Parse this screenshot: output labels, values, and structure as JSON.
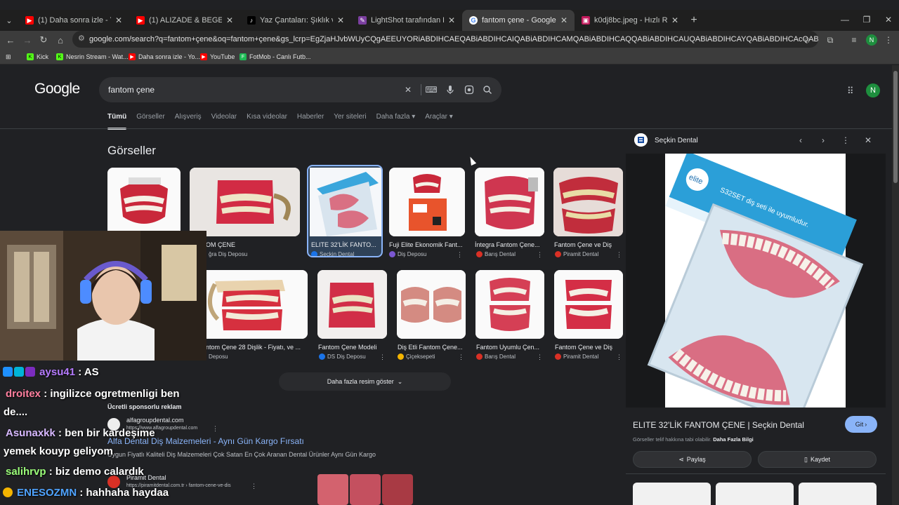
{
  "browser": {
    "tabs": [
      {
        "title": "(1) Daha sonra izle - YouTube",
        "favicon": "youtube-icon",
        "color": "#ff0000"
      },
      {
        "title": "(1) ALIZADE & BEGE - 24/7 (Of...",
        "favicon": "youtube-icon",
        "color": "#ff0000"
      },
      {
        "title": "Yaz Çantaları: Şıklık ve Kullanışlı...",
        "favicon": "tiktok-icon",
        "color": "#000000"
      },
      {
        "title": "LightShot tarafından Ekran Görü...",
        "favicon": "feather-icon",
        "color": "#9b59b6"
      },
      {
        "title": "fantom çene - Google'da Ara",
        "favicon": "google-icon",
        "color": "#4285f4"
      },
      {
        "title": "k0dj8bc.jpeg - Hızlı Resim",
        "favicon": "image-icon",
        "color": "#c2185b"
      }
    ],
    "new_tab": "+",
    "url": "google.com/search?q=fantom+çene&oq=fantom+çene&gs_lcrp=EgZjaHJvbWUyCQgAEEUYORiABDIHCAEQABiABDIHCAIQABiABDIHCAMQABiABDIHCAQQABiABDIHCAUQABiABDIHCAYQABiABDIHCAcQABiABDIHCAgQABiABDIHCAkQABiABNI...",
    "profile_initial": "N",
    "bookmarks": [
      {
        "label": "Kick",
        "color": "#53fc18"
      },
      {
        "label": "Nesrin Stream - Wat...",
        "color": "#53fc18"
      },
      {
        "label": "Daha sonra izle - Yo...",
        "color": "#ff0000"
      },
      {
        "label": "YouTube",
        "color": "#ff0000"
      },
      {
        "label": "FotMob - Canlı Futb...",
        "color": "#1db954"
      }
    ]
  },
  "google": {
    "logo": "Google",
    "query": "fantom çene",
    "avatar_initial": "N",
    "nav": [
      "Tümü",
      "Görseller",
      "Alışveriş",
      "Videolar",
      "Kısa videolar",
      "Haberler",
      "Yer siteleri",
      "Daha fazla",
      "Araçlar"
    ],
    "images_heading": "Görseller",
    "images_row1": [
      {
        "title": "",
        "source": ""
      },
      {
        "title": "OM ÇENE",
        "source": "ğra Diş Deposu"
      },
      {
        "title": "ELITE 32'LİK FANTO...",
        "source": "Seçkin Dental"
      },
      {
        "title": "Fuji Elite Ekonomik Fant...",
        "source": "Diş Deposu"
      },
      {
        "title": "İntegra Fantom Çene...",
        "source": "Barış Dental"
      },
      {
        "title": "Fantom Çene ve Diş",
        "source": "Piramit Dental"
      }
    ],
    "images_row2": [
      {
        "title": "ntom Çene 28 Dişlik - Fiyatı, ve ...",
        "source": "Deposu"
      },
      {
        "title": "Fantom Çene Modeli",
        "source": "DS Diş Deposu"
      },
      {
        "title": "Diş Etli Fantom Çene...",
        "source": "Çiçeksepeti"
      },
      {
        "title": "Fantom Uyumlu Çen...",
        "source": "Barış Dental"
      },
      {
        "title": "Fantom Çene ve Diş",
        "source": "Piramit Dental"
      }
    ],
    "more_images": "Daha fazla resim göster",
    "sponsored_label": "Ücretli sponsorlu reklam",
    "ads": [
      {
        "host": "alfagroupdental.com",
        "url": "https://www.alfagroupdental.com",
        "title": "Alfa Dental Diş Malzemeleri - Aynı Gün Kargo Fırsatı",
        "desc": "Uygun Fiyatlı Kaliteli Diş Malzemeleri Çok Satan En Çok Aranan Dental Ürünler Aynı Gün Kargo"
      },
      {
        "host": "Piramit Dental",
        "url": "https://piramitdental.com.tr › fantom-cene-ve-dis"
      }
    ]
  },
  "panel": {
    "source": "Seçkin Dental",
    "title": "ELITE 32'LİK FANTOM ÇENE | Seçkin Dental",
    "visit": "Git",
    "notice": "Görseller telif hakkına tabi olabilir.",
    "notice_link": "Daha Fazla Bilgi",
    "share": "Paylaş",
    "save": "Kaydet",
    "box_brand": "elite",
    "box_text": "S32SET diş seti ile uyumludur."
  },
  "stream_chat": {
    "messages": [
      {
        "user": "aysu41",
        "text": ": AS",
        "color": "#b57bff"
      },
      {
        "user": "droitex",
        "text": ": ingilizce ogretmenligi ben",
        "cont": "de....",
        "color": "#ff7f9f"
      },
      {
        "user": "Asunaxkk",
        "text": ": ben bir kardeşime",
        "cont": "yemek kouyp geliyom",
        "color": "#d7b8ff"
      },
      {
        "user": "salihrvp",
        "text": ": biz demo calardık",
        "color": "#9cff7a"
      },
      {
        "user": "ENESOZMN",
        "text": ": hahhaha haydaa",
        "color": "#4fa3ff"
      }
    ]
  }
}
